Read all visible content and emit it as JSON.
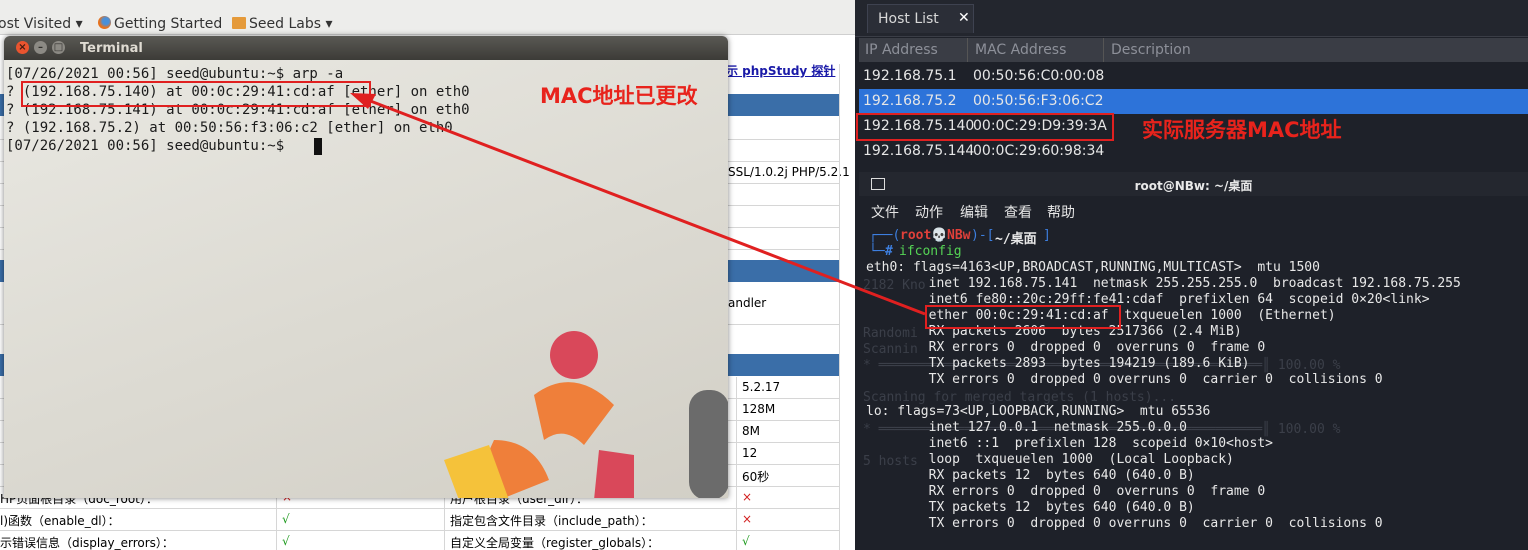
{
  "browser": {
    "bookmarks": [
      {
        "label": "ost Visited ▾",
        "icon": "none"
      },
      {
        "label": "Getting Started",
        "icon": "firefox-icon"
      },
      {
        "label": "Seed Labs ▾",
        "icon": "folder-icon"
      }
    ],
    "phpstudy_link": "示 phpStudy 探针",
    "side_texts": [
      "SSL/1.0.2j PHP/5.2.1",
      "andler"
    ],
    "values": [
      "5.2.17",
      "128M",
      "8M",
      "12",
      "60秒"
    ],
    "rows": [
      {
        "c1": "HP页面根目录（doc_root）：",
        "v1": "×",
        "c2": "用户根目录（user_dir）：",
        "v2": "×"
      },
      {
        "c1": "l)函数（enable_dl）：",
        "v1": "√",
        "c2": "指定包含文件目录（include_path）：",
        "v2": "×"
      },
      {
        "c1": "示错误信息（display_errors）：",
        "v1": "√",
        "c2": "自定义全局变量（register_globals）：",
        "v2": "√"
      }
    ]
  },
  "terminal": {
    "title": "Terminal",
    "lines": [
      "[07/26/2021 00:56] seed@ubuntu:~$ arp -a",
      "? (192.168.75.140) at 00:0c:29:41:cd:af [ether] on eth0",
      "? (192.168.75.141) at 00:0c:29:41:cd:af [ether] on eth0",
      "? (192.168.75.2) at 00:50:56:f3:06:c2 [ether] on eth0",
      "[07/26/2021 00:56] seed@ubuntu:~$ "
    ],
    "annotation": "MAC地址已更改"
  },
  "hostlist": {
    "tab_label": "Host List",
    "close": "✕",
    "headers": [
      "IP Address",
      "MAC Address",
      "Description"
    ],
    "rows": [
      {
        "ip": "192.168.75.1",
        "mac": "00:50:56:C0:00:08",
        "selected": false
      },
      {
        "ip": "192.168.75.2",
        "mac": "00:50:56:F3:06:C2",
        "selected": true
      },
      {
        "ip": "192.168.75.140",
        "mac": "00:0C:29:D9:39:3A",
        "selected": false
      },
      {
        "ip": "192.168.75.144",
        "mac": "00:0C:29:60:98:34",
        "selected": false
      }
    ],
    "annotation": "实际服务器MAC地址"
  },
  "kali_terminal": {
    "title": "root@NBw: ~/桌面",
    "menu": [
      "文件",
      "动作",
      "编辑",
      "查看",
      "帮助"
    ],
    "prompt_user": "root",
    "prompt_host": "NBw",
    "prompt_dir": "~/桌面",
    "command": "ifconfig",
    "lines": [
      "eth0: flags=4163<UP,BROADCAST,RUNNING,MULTICAST>  mtu 1500",
      "        inet 192.168.75.141  netmask 255.255.255.0  broadcast 192.168.75.255",
      "        inet6 fe80::20c:29ff:fe41:cdaf  prefixlen 64  scopeid 0×20<link>",
      "        ether 00:0c:29:41:cd:af  txqueuelen 1000  (Ethernet)",
      "        RX packets 2606  bytes 2517366 (2.4 MiB)",
      "        RX errors 0  dropped 0  overruns 0  frame 0",
      "        TX packets 2893  bytes 194219 (189.6 KiB)",
      "        TX errors 0  dropped 0 overruns 0  carrier 0  collisions 0",
      "",
      "lo: flags=73<UP,LOOPBACK,RUNNING>  mtu 65536",
      "        inet 127.0.0.1  netmask 255.0.0.0",
      "        inet6 ::1  prefixlen 128  scopeid 0×10<host>",
      "        loop  txqueuelen 1000  (Local Loopback)",
      "        RX packets 12  bytes 640 (640.0 B)",
      "        RX errors 0  dropped 0  overruns 0  frame 0",
      "        TX packets 12  bytes 640 (640.0 B)",
      "        TX errors 0  dropped 0 overruns 0  carrier 0  collisions 0"
    ]
  },
  "colors": {
    "annotation_red": "#e8231c",
    "selection_blue": "#2d73d9",
    "prompt_blue": "#3d7fe0",
    "prompt_red": "#e0403a"
  }
}
